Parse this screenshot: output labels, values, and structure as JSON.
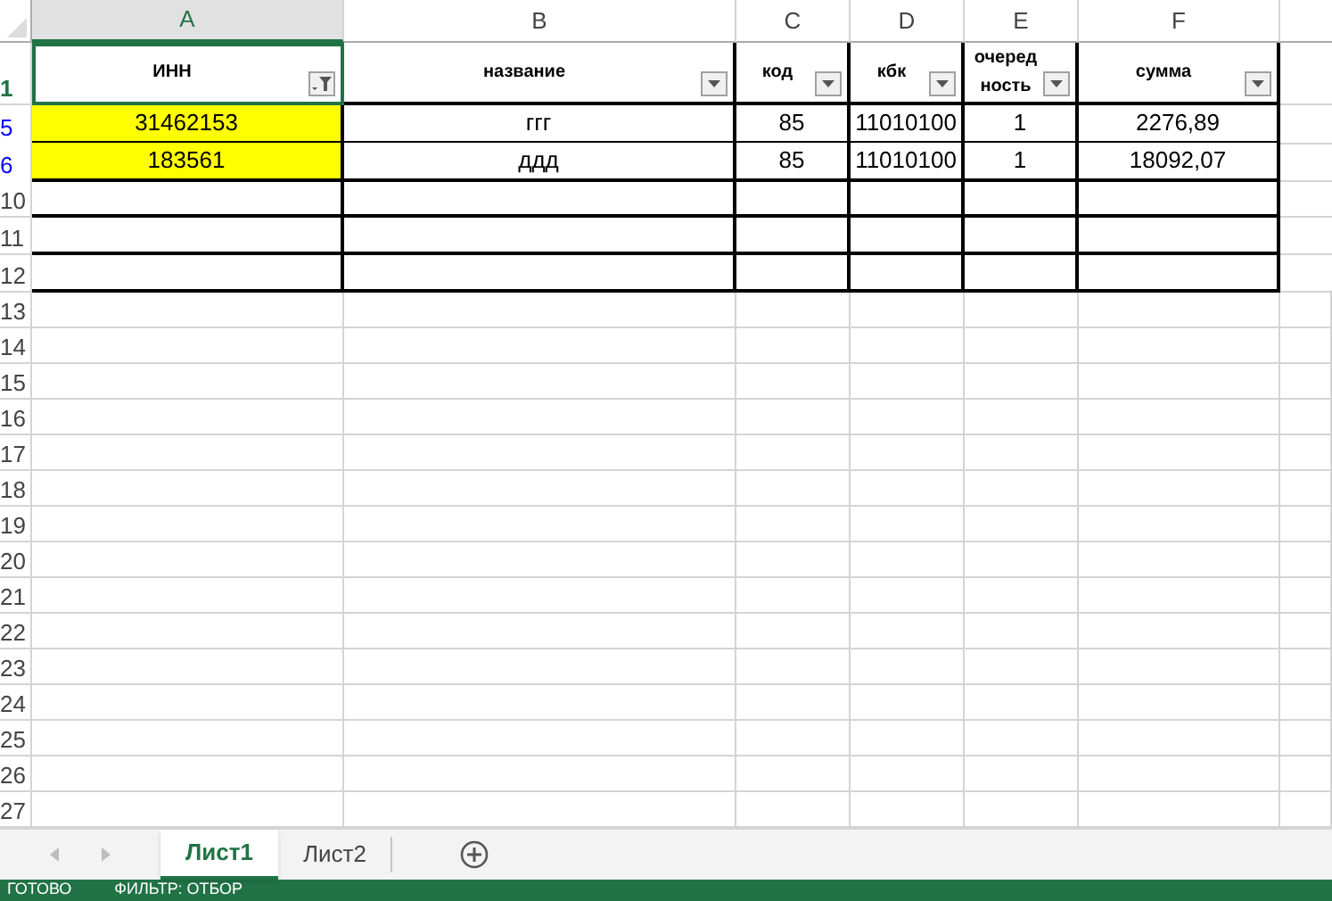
{
  "column_headers": [
    {
      "label": "A",
      "selected": true
    },
    {
      "label": "B",
      "selected": false
    },
    {
      "label": "C",
      "selected": false
    },
    {
      "label": "D",
      "selected": false
    },
    {
      "label": "E",
      "selected": false
    },
    {
      "label": "F",
      "selected": false
    }
  ],
  "header_row": {
    "row_number": "1",
    "selected": true,
    "cells": [
      {
        "text": "ИНН",
        "filter_applied": true,
        "selected": true
      },
      {
        "text": "название",
        "filter_applied": false,
        "selected": false
      },
      {
        "text": "код",
        "filter_applied": false,
        "selected": false
      },
      {
        "text": "кбк",
        "filter_applied": false,
        "selected": false
      },
      {
        "text": "очередность",
        "filter_applied": false,
        "selected": false
      },
      {
        "text": "сумма",
        "filter_applied": false,
        "selected": false
      }
    ]
  },
  "rows": [
    {
      "row_number": "5",
      "filtered": true,
      "cells": [
        {
          "text": "31462153",
          "highlight": true
        },
        {
          "text": "ггг",
          "highlight": false
        },
        {
          "text": "85",
          "highlight": false
        },
        {
          "text": "11010100",
          "highlight": false
        },
        {
          "text": "1",
          "highlight": false
        },
        {
          "text": "2276,89",
          "highlight": false
        }
      ]
    },
    {
      "row_number": "6",
      "filtered": true,
      "cells": [
        {
          "text": "183561",
          "highlight": true
        },
        {
          "text": "ддд",
          "highlight": false
        },
        {
          "text": "85",
          "highlight": false
        },
        {
          "text": "11010100",
          "highlight": false
        },
        {
          "text": "1",
          "highlight": false
        },
        {
          "text": "18092,07",
          "highlight": false
        }
      ]
    }
  ],
  "bordered_empty_rows": [
    "10",
    "11",
    "12"
  ],
  "blank_rows": [
    "13",
    "14",
    "15",
    "16",
    "17",
    "18",
    "19",
    "20",
    "21",
    "22",
    "23",
    "24",
    "25",
    "26",
    "27"
  ],
  "sheet_tabs": [
    {
      "label": "Лист1",
      "selected": true
    },
    {
      "label": "Лист2",
      "selected": false
    }
  ],
  "status_bar": [
    "ГОТОВО",
    "ФИЛЬТР: ОТБОР"
  ]
}
